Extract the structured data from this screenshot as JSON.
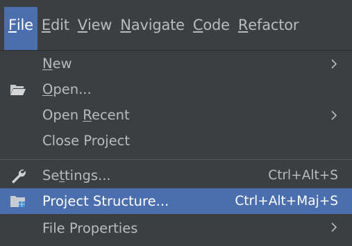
{
  "menubar": {
    "items": [
      {
        "label": "File",
        "mnemonic": "F",
        "active": true
      },
      {
        "label": "Edit",
        "mnemonic": "E",
        "active": false
      },
      {
        "label": "View",
        "mnemonic": "V",
        "active": false
      },
      {
        "label": "Navigate",
        "mnemonic": "N",
        "active": false
      },
      {
        "label": "Code",
        "mnemonic": "C",
        "active": false
      },
      {
        "label": "Refactor",
        "mnemonic": "R",
        "active": false
      }
    ]
  },
  "file_menu": {
    "items": [
      {
        "label": "New",
        "icon": "",
        "shortcut": "",
        "submenu": true
      },
      {
        "label": "Open...",
        "icon": "folder-icon",
        "shortcut": "",
        "submenu": false
      },
      {
        "label": "Open Recent",
        "icon": "",
        "shortcut": "",
        "submenu": true
      },
      {
        "label": "Close Project",
        "icon": "",
        "shortcut": "",
        "submenu": false
      },
      {
        "label": "Settings...",
        "icon": "wrench-icon",
        "shortcut": "Ctrl+Alt+S",
        "submenu": false
      },
      {
        "label": "Project Structure...",
        "icon": "project-structure-icon",
        "shortcut": "Ctrl+Alt+Maj+S",
        "submenu": false,
        "selected": true
      },
      {
        "label": "File Properties",
        "icon": "",
        "shortcut": "",
        "submenu": true
      }
    ]
  },
  "colors": {
    "background": "#3c3f41",
    "selection": "#4b6eaf",
    "text": "#bbbbbb",
    "selected_text": "#ffffff"
  }
}
